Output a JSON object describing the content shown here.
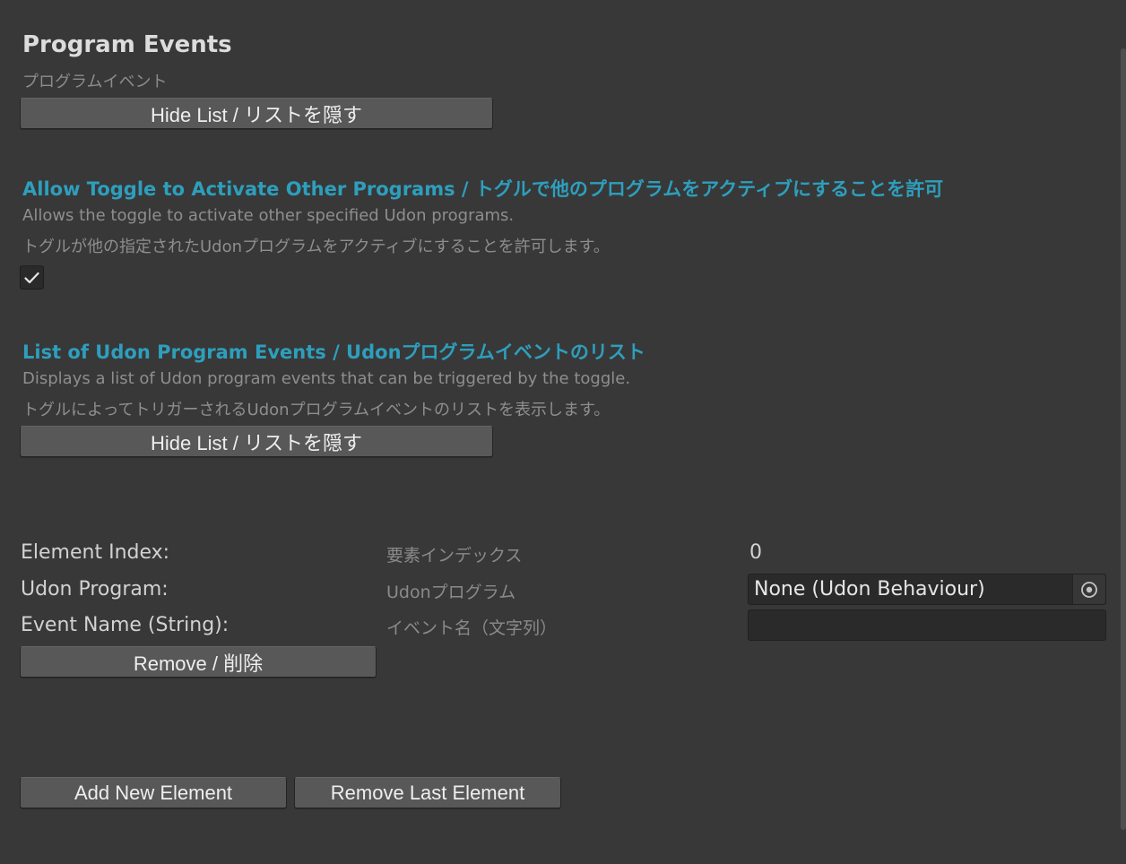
{
  "header": {
    "title": "Program Events",
    "subtitle": "プログラムイベント"
  },
  "buttons": {
    "hide_list_1": "Hide List / リストを隠す",
    "hide_list_2": "Hide List / リストを隠す",
    "remove": "Remove / 削除",
    "add_new": "Add New Element",
    "remove_last": "Remove Last Element"
  },
  "allow_toggle": {
    "heading": "Allow Toggle to Activate Other Programs / トグルで他のプログラムをアクティブにすることを許可",
    "desc_en": "Allows the toggle to activate other specified Udon programs.",
    "desc_jp": "トグルが他の指定されたUdonプログラムをアクティブにすることを許可します。",
    "checked": true
  },
  "events_list": {
    "heading": "List of Udon Program Events / Udonプログラムイベントのリスト",
    "desc_en": "Displays a list of Udon program events that can be triggered by the toggle.",
    "desc_jp": "トグルによってトリガーされるUdonプログラムイベントのリストを表示します。"
  },
  "element": {
    "index_label": "Element Index:",
    "index_label_jp": "要素インデックス",
    "index_value": "0",
    "program_label": "Udon Program:",
    "program_label_jp": "Udonプログラム",
    "program_value": "None (Udon Behaviour)",
    "event_label": "Event Name (String):",
    "event_label_jp": "イベント名（文字列）",
    "event_value": ""
  },
  "icons": {
    "checkbox": "checkmark-icon",
    "object_picker": "target-icon"
  },
  "colors": {
    "background": "#383838",
    "accent_heading": "#2d9fbd",
    "button": "#585858",
    "field": "#2a2a2a"
  }
}
